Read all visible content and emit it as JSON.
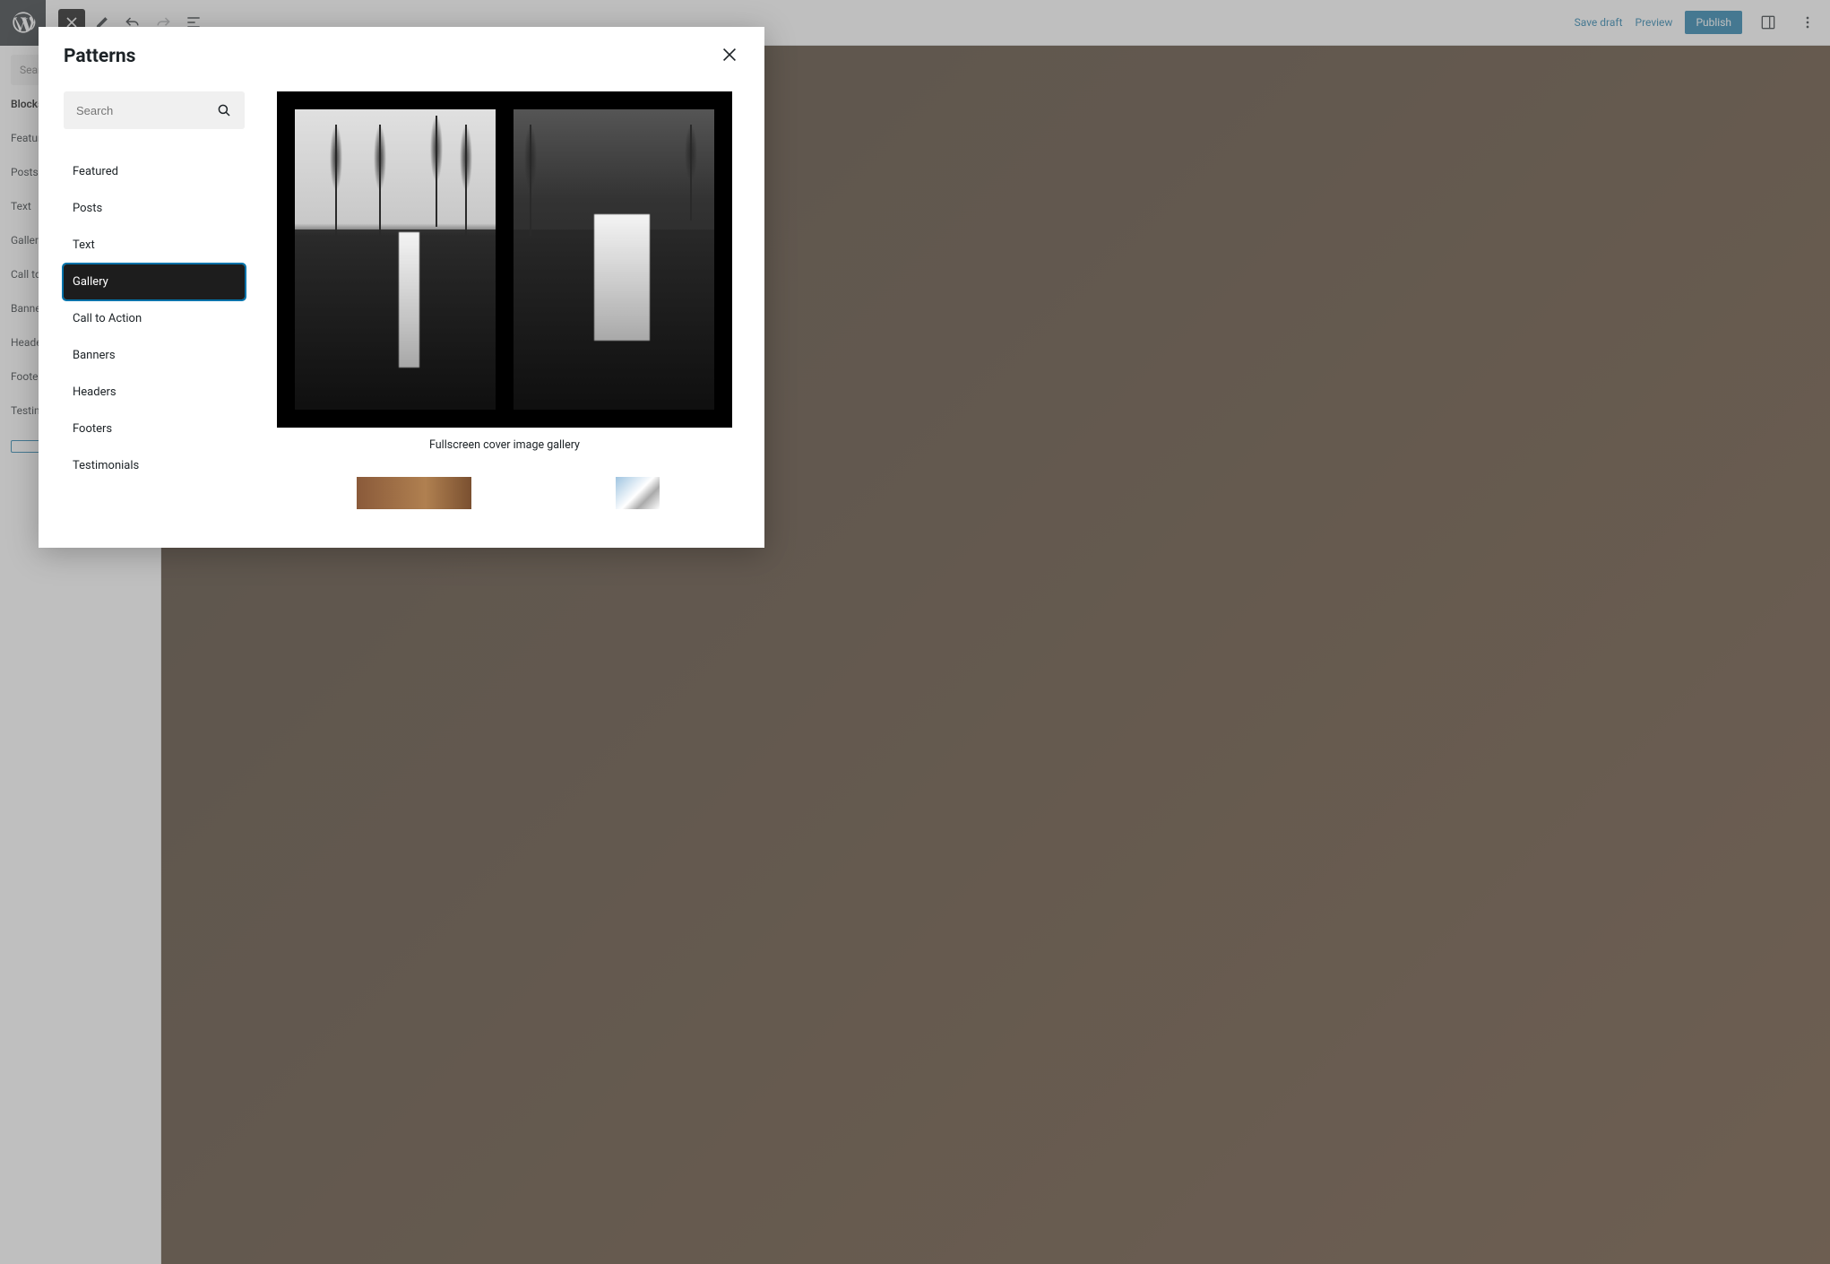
{
  "toolbar": {
    "save_draft": "Save draft",
    "preview": "Preview",
    "publish": "Publish"
  },
  "background_sidebar": {
    "search_placeholder": "Search",
    "tab_label": "Blocks",
    "categories": [
      "Featured",
      "Posts",
      "Text",
      "Gallery",
      "Call to Action",
      "Banners",
      "Headers",
      "Footers",
      "Testimonials"
    ]
  },
  "modal": {
    "title": "Patterns",
    "search_placeholder": "Search",
    "categories": [
      {
        "label": "Featured",
        "active": false
      },
      {
        "label": "Posts",
        "active": false
      },
      {
        "label": "Text",
        "active": false
      },
      {
        "label": "Gallery",
        "active": true
      },
      {
        "label": "Call to Action",
        "active": false
      },
      {
        "label": "Banners",
        "active": false
      },
      {
        "label": "Headers",
        "active": false
      },
      {
        "label": "Footers",
        "active": false
      },
      {
        "label": "Testimonials",
        "active": false
      }
    ],
    "patterns": [
      {
        "caption": "Fullscreen cover image gallery"
      }
    ]
  },
  "colors": {
    "accent": "#0073aa",
    "text": "#1d2327",
    "panel_bg": "#ffffff",
    "active_bg": "#1d1d1d"
  }
}
